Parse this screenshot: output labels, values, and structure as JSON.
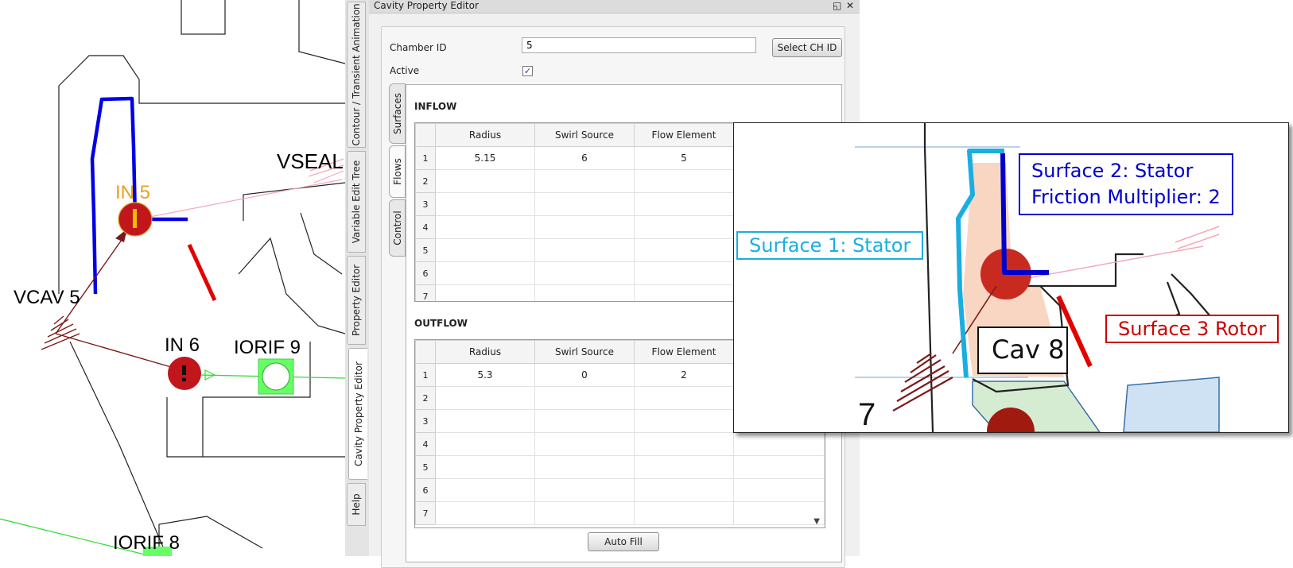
{
  "canvas": {
    "labels": {
      "in5": "IN 5",
      "vseal": "VSEAL",
      "vcav5": "VCAV 5",
      "in6": "IN 6",
      "iorif9": "IORIF 9",
      "iorif8": "IORIF 8"
    },
    "colors": {
      "surface_blue": "#0000e6",
      "node_red": "#c0161c",
      "rotor_red": "#e30000",
      "orifice_green": "#66ff66"
    }
  },
  "side_tabs": [
    "Contour / Transient Animation",
    "Variable Edit Tree",
    "Property Editor",
    "Cavity Property Editor",
    "Help"
  ],
  "panel": {
    "title": "Cavity Property Editor",
    "restore_glyph": "◱",
    "close_glyph": "✕",
    "chamber_id_label": "Chamber ID",
    "chamber_id_value": "5",
    "select_button": "Select CH ID",
    "active_label": "Active",
    "active_checked": "✓",
    "inner_tabs": [
      "Surfaces",
      "Flows",
      "Control"
    ],
    "inflow": {
      "title": "INFLOW",
      "columns": [
        "Radius",
        "Swirl Source",
        "Flow Element"
      ],
      "rows": [
        [
          "1",
          "5.15",
          "6",
          "5"
        ],
        [
          "2",
          "",
          "",
          ""
        ],
        [
          "3",
          "",
          "",
          ""
        ],
        [
          "4",
          "",
          "",
          ""
        ],
        [
          "5",
          "",
          "",
          ""
        ],
        [
          "6",
          "",
          "",
          ""
        ],
        [
          "7",
          "",
          "",
          ""
        ]
      ]
    },
    "outflow": {
      "title": "OUTFLOW",
      "columns": [
        "Radius",
        "Swirl Source",
        "Flow Element"
      ],
      "rows": [
        [
          "1",
          "5.3",
          "0",
          "2"
        ],
        [
          "2",
          "",
          "",
          ""
        ],
        [
          "3",
          "",
          "",
          ""
        ],
        [
          "4",
          "",
          "",
          ""
        ],
        [
          "5",
          "",
          "",
          ""
        ],
        [
          "6",
          "",
          "",
          ""
        ],
        [
          "7",
          "",
          "",
          ""
        ]
      ]
    },
    "auto_fill_button": "Auto Fill"
  },
  "inset": {
    "surface1": "Surface 1: Stator",
    "surface2_line1": "Surface 2: Stator",
    "surface2_line2": "Friction Multiplier: 2",
    "surface3": "Surface 3 Rotor",
    "cav": "Cav 8",
    "colors": {
      "surface1": "#1aaee0",
      "surface2": "#0000cc",
      "surface3": "#cc0000"
    }
  }
}
